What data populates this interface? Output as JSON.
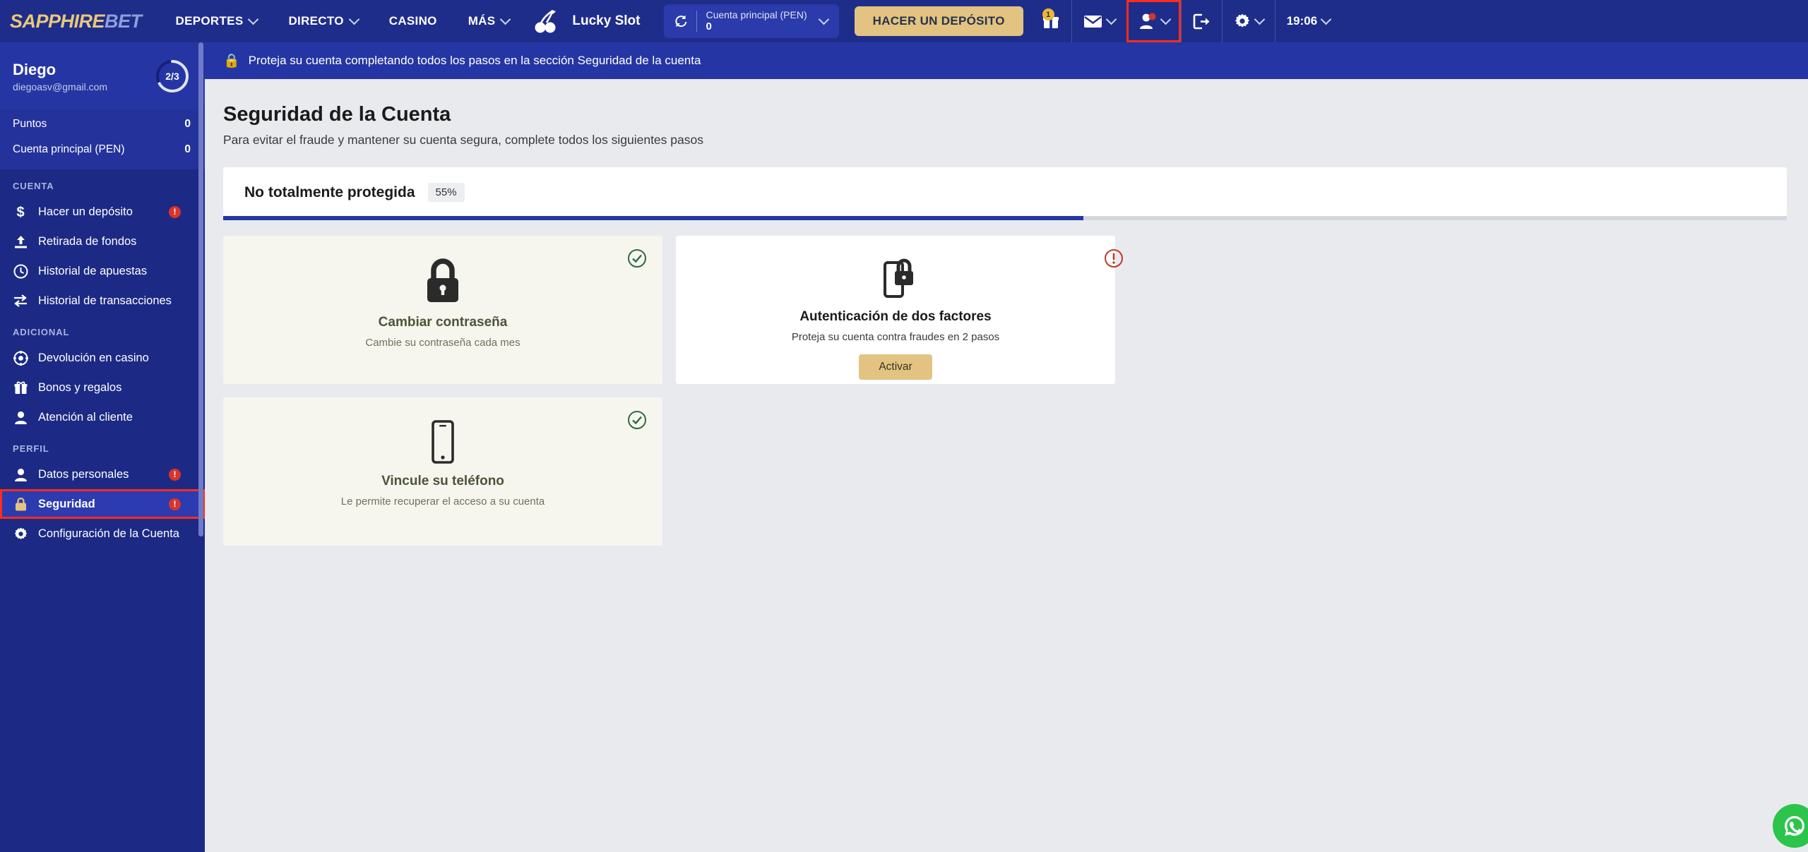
{
  "header": {
    "logo_primary": "SAPPHIRE",
    "logo_secondary": "BET",
    "nav": [
      {
        "label": "DEPORTES",
        "caret": true
      },
      {
        "label": "DIRECTO",
        "caret": true
      },
      {
        "label": "CASINO",
        "caret": false
      },
      {
        "label": "MÁS",
        "caret": true
      }
    ],
    "promo_label": "Lucky Slot",
    "balance": {
      "label": "Cuenta principal  (PEN)",
      "value": "0"
    },
    "deposit_button": "HACER UN DEPÓSITO",
    "gift_badge": "1",
    "clock": "19:06"
  },
  "sidebar": {
    "profile": {
      "name": "Diego",
      "email": "diegoasv@gmail.com",
      "progress_label": "2/3",
      "progress_done": 2,
      "progress_total": 3
    },
    "balances": [
      {
        "label": "Puntos",
        "value": "0"
      },
      {
        "label": "Cuenta principal (PEN)",
        "value": "0"
      }
    ],
    "sections": [
      {
        "title": "CUENTA",
        "items": [
          {
            "label": "Hacer un depósito",
            "icon": "dollar-icon",
            "warn": true,
            "active": false
          },
          {
            "label": "Retirada de fondos",
            "icon": "upload-icon",
            "warn": false,
            "active": false
          },
          {
            "label": "Historial de apuestas",
            "icon": "clock-icon",
            "warn": false,
            "active": false
          },
          {
            "label": "Historial de transacciones",
            "icon": "transfer-icon",
            "warn": false,
            "active": false
          }
        ]
      },
      {
        "title": "ADICIONAL",
        "items": [
          {
            "label": "Devolución en casino",
            "icon": "chip-icon",
            "warn": false,
            "active": false
          },
          {
            "label": "Bonos y regalos",
            "icon": "gift-icon",
            "warn": false,
            "active": false
          },
          {
            "label": "Atención al cliente",
            "icon": "support-icon",
            "warn": false,
            "active": false
          }
        ]
      },
      {
        "title": "PERFIL",
        "items": [
          {
            "label": "Datos personales",
            "icon": "person-icon",
            "warn": true,
            "active": false
          },
          {
            "label": "Seguridad",
            "icon": "lock-icon",
            "warn": true,
            "active": true
          },
          {
            "label": "Configuración de la Cuenta",
            "icon": "gear-icon",
            "warn": false,
            "active": false
          }
        ]
      }
    ]
  },
  "notice": {
    "icon": "lock-icon",
    "text": "Proteja su cuenta completando todos los pasos en la sección Seguridad de la cuenta"
  },
  "page": {
    "title": "Seguridad de la Cuenta",
    "subtitle": "Para evitar el fraude y mantener su cuenta segura, complete todos los siguientes pasos",
    "protection": {
      "status_label": "No totalmente protegida",
      "percent_label": "55%",
      "percent_value": 55
    },
    "cards": [
      {
        "title": "Cambiar contraseña",
        "description": "Cambie su contraseña cada mes",
        "icon": "padlock-icon",
        "state": "done",
        "status_icon": "check-circle-icon",
        "action": null
      },
      {
        "title": "Autenticación de dos factores",
        "description": "Proteja su cuenta contra fraudes en 2 pasos",
        "icon": "phone-lock-icon",
        "state": "todo",
        "status_icon": "alert-circle-icon",
        "action": "Activar"
      },
      {
        "title": "Vincule su teléfono",
        "description": "Le permite recuperar el acceso a su cuenta",
        "icon": "phone-icon",
        "state": "done",
        "status_icon": "check-circle-icon",
        "action": null
      }
    ]
  },
  "colors": {
    "brand_blue": "#1f2d8a",
    "sidebar_blue": "#1c2a85",
    "accent_gold": "#e3c381",
    "alert_red": "#d9342b",
    "highlight_red": "#ff2d1a",
    "progress_blue": "#2536a4",
    "whatsapp_green": "#2cc44b"
  }
}
